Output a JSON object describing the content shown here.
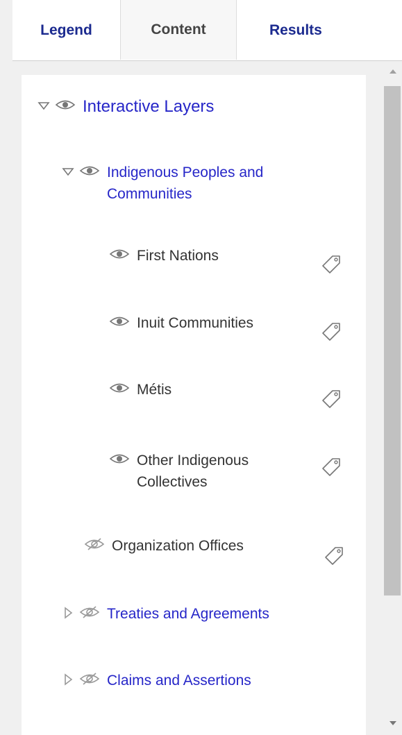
{
  "tabs": {
    "legend": "Legend",
    "content": "Content",
    "results": "Results"
  },
  "tree": {
    "root": "Interactive Layers",
    "group_indigenous": "Indigenous Peoples and Communities",
    "first_nations": "First Nations",
    "inuit": "Inuit Communities",
    "metis": "Métis",
    "other": "Other Indigenous Collectives",
    "org_offices": "Organization Offices",
    "treaties": "Treaties and Agreements",
    "claims": "Claims and Assertions"
  },
  "icons": {
    "expanded": "caret-down-icon",
    "collapsed": "caret-right-icon",
    "visible": "eye-icon",
    "hidden": "eye-off-icon",
    "tag": "tag-icon"
  },
  "colors": {
    "tab_active": "#1b2a8f",
    "group_label": "#2626c8",
    "layer_label": "#333333"
  }
}
